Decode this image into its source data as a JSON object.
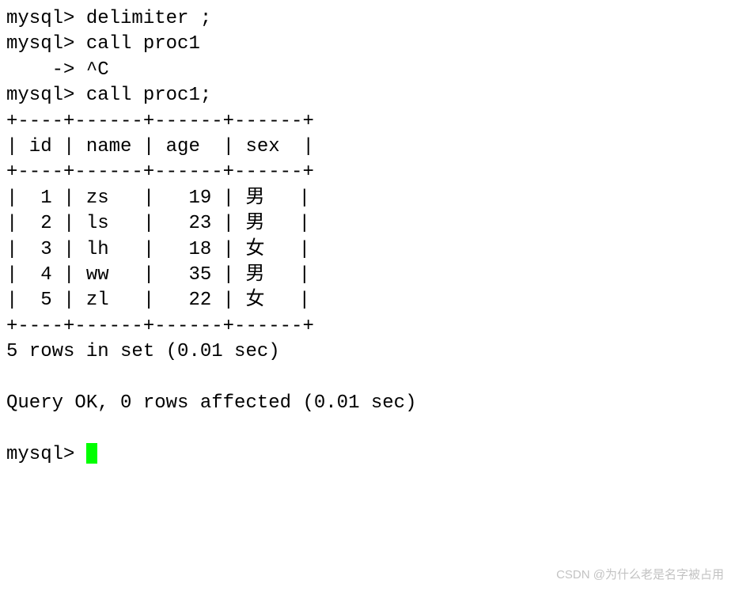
{
  "lines": [
    "mysql> delimiter ;",
    "mysql> call proc1",
    "    -> ^C",
    "mysql> call proc1;",
    "+----+------+------+------+",
    "| id | name | age  | sex  |",
    "+----+------+------+------+",
    "|  1 | zs   |   19 | 男   |",
    "|  2 | ls   |   23 | 男   |",
    "|  3 | lh   |   18 | 女   |",
    "|  4 | ww   |   35 | 男   |",
    "|  5 | zl   |   22 | 女   |",
    "+----+------+------+------+",
    "5 rows in set (0.01 sec)",
    "",
    "Query OK, 0 rows affected (0.01 sec)",
    "",
    "mysql> "
  ],
  "watermark": "CSDN @为什么老是名字被占用",
  "chart_data": {
    "type": "table",
    "columns": [
      "id",
      "name",
      "age",
      "sex"
    ],
    "rows": [
      [
        1,
        "zs",
        19,
        "男"
      ],
      [
        2,
        "ls",
        23,
        "男"
      ],
      [
        3,
        "lh",
        18,
        "女"
      ],
      [
        4,
        "ww",
        35,
        "男"
      ],
      [
        5,
        "zl",
        22,
        "女"
      ]
    ],
    "row_count_message": "5 rows in set (0.01 sec)",
    "status_message": "Query OK, 0 rows affected (0.01 sec)"
  }
}
